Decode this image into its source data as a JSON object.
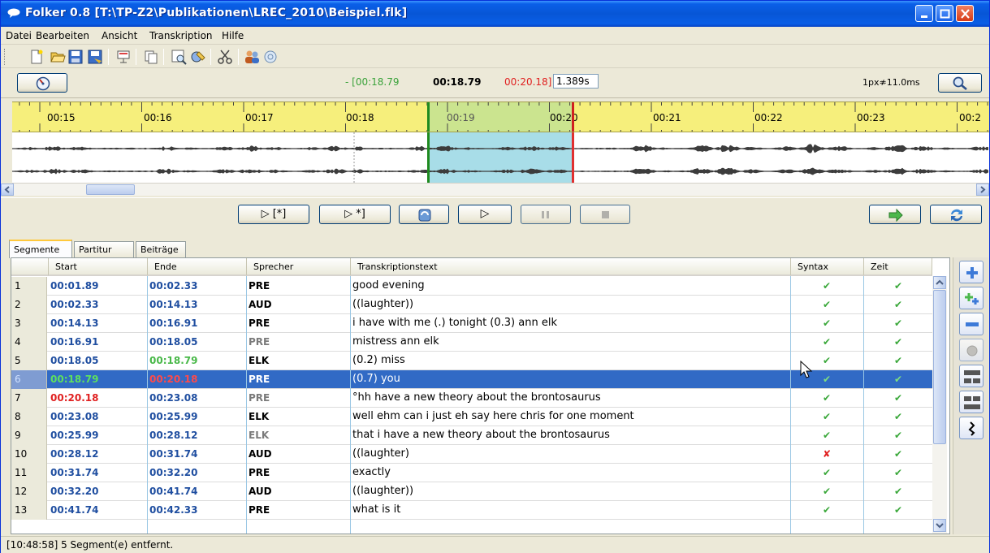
{
  "window": {
    "title": "Folker 0.8 [T:\\TP-Z2\\Publikationen\\LREC_2010\\Beispiel.flk]"
  },
  "menu": [
    "Datei",
    "Bearbeiten",
    "Ansicht",
    "Transkription",
    "Hilfe"
  ],
  "timebar": {
    "selection_start": "- [00:18.79",
    "position": "00:18.79",
    "selection_end": "00:20.18]",
    "duration": "1.389s",
    "zoom": "1px≉11.0ms"
  },
  "ruler": {
    "ticks": [
      "00:15",
      "00:16",
      "00:17",
      "00:18",
      "00:19",
      "00:20",
      "00:21",
      "00:22",
      "00:23",
      "00:2"
    ]
  },
  "playback": {
    "play_selection_label": "▷ [*]",
    "play_from_label": "▷ *]",
    "play_label": "▷"
  },
  "tabs": [
    "Segmente",
    "Partitur",
    "Beiträge"
  ],
  "table": {
    "headers": [
      "Start",
      "Ende",
      "Sprecher",
      "Transkriptionstext",
      "Syntax",
      "Zeit"
    ],
    "rows": [
      {
        "num": "1",
        "start": "00:01.89",
        "end": "00:02.33",
        "speaker": "PRE",
        "text": "good evening",
        "syntax": "✔",
        "zeit": "✔"
      },
      {
        "num": "2",
        "start": "00:02.33",
        "end": "00:14.13",
        "speaker": "AUD",
        "text": "((laughter))",
        "syntax": "✔",
        "zeit": "✔"
      },
      {
        "num": "3",
        "start": "00:14.13",
        "end": "00:16.91",
        "speaker": "PRE",
        "text": "i have with me (.) tonight (0.3) ann elk",
        "syntax": "✔",
        "zeit": "✔"
      },
      {
        "num": "4",
        "start": "00:16.91",
        "end": "00:18.05",
        "speaker": "PRE",
        "text": "mistress ann elk",
        "syntax": "✔",
        "zeit": "✔"
      },
      {
        "num": "5",
        "start": "00:18.05",
        "end": "00:18.79",
        "speaker": "ELK",
        "text": "(0.2) miss",
        "syntax": "✔",
        "zeit": "✔"
      },
      {
        "num": "6",
        "start": "00:18.79",
        "end": "00:20.18",
        "speaker": "PRE",
        "text": "(0.7) you",
        "syntax": "✔",
        "zeit": "✔"
      },
      {
        "num": "7",
        "start": "00:20.18",
        "end": "00:23.08",
        "speaker": "PRE",
        "text": "°hh have a new theory about the brontosaurus",
        "syntax": "✔",
        "zeit": "✔"
      },
      {
        "num": "8",
        "start": "00:23.08",
        "end": "00:25.99",
        "speaker": "ELK",
        "text": "well ehm can i just eh say here chris for one moment",
        "syntax": "✔",
        "zeit": "✔"
      },
      {
        "num": "9",
        "start": "00:25.99",
        "end": "00:28.12",
        "speaker": "ELK",
        "text": "that i have a new theory about the brontosaurus",
        "syntax": "✔",
        "zeit": "✔"
      },
      {
        "num": "10",
        "start": "00:28.12",
        "end": "00:31.74",
        "speaker": "AUD",
        "text": "((laughter)",
        "syntax": "✘",
        "zeit": "✔"
      },
      {
        "num": "11",
        "start": "00:31.74",
        "end": "00:32.20",
        "speaker": "PRE",
        "text": "exactly",
        "syntax": "✔",
        "zeit": "✔"
      },
      {
        "num": "12",
        "start": "00:32.20",
        "end": "00:41.74",
        "speaker": "AUD",
        "text": "((laughter))",
        "syntax": "✔",
        "zeit": "✔"
      },
      {
        "num": "13",
        "start": "00:41.74",
        "end": "00:42.33",
        "speaker": "PRE",
        "text": "what is it",
        "syntax": "✔",
        "zeit": "✔"
      }
    ]
  },
  "status": "[10:48:58] 5 Segment(e) entfernt."
}
